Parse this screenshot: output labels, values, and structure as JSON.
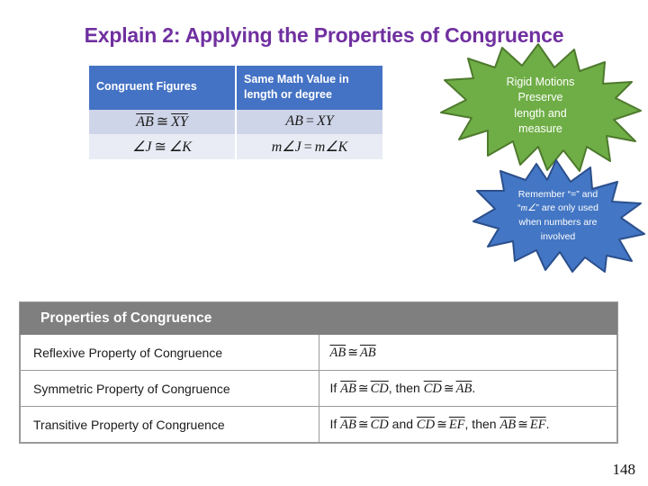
{
  "slide": {
    "title": "Explain 2:  Applying the Properties of Congruence",
    "title_color": "#7030A0",
    "page_number": "148"
  },
  "congruence_table": {
    "headers": [
      "Congruent Figures",
      "Same Math Value in length or degree"
    ],
    "header_bg": "#4472C4",
    "row_bg_1": "#CFD5E8",
    "row_bg_2": "#E9ECF5",
    "rows": [
      {
        "left_a": "AB",
        "left_op": "≅",
        "left_b": "XY",
        "right_a": "AB",
        "right_op": "=",
        "right_b": "XY"
      },
      {
        "left_a": "∠J",
        "left_op": "≅",
        "left_b": "∠K",
        "right_a": "m∠J",
        "right_op": "=",
        "right_b": "m∠K"
      }
    ]
  },
  "bursts": {
    "green": {
      "color": "#6FAE46",
      "outline": "#4E7A2E",
      "lines": [
        "Rigid Motions",
        "Preserve",
        "length and",
        "measure"
      ]
    },
    "blue": {
      "color": "#4376C4",
      "outline": "#2B4F8C",
      "line1": "Remember “=” and",
      "line2_math": "m∠",
      "line2_pre": "“",
      "line2_post": "” are only used",
      "line3": "when numbers are",
      "line4": "involved"
    }
  },
  "properties_table": {
    "header": "Properties of Congruence",
    "header_bg": "#7F7F7F",
    "rows": [
      {
        "name": "Reflexive Property of Congruence",
        "statement_parts": [
          {
            "t": "AB",
            "style": "seg"
          },
          {
            "t": "≅",
            "style": "cong"
          },
          {
            "t": "AB",
            "style": "seg"
          }
        ]
      },
      {
        "name": "Symmetric Property of Congruence",
        "statement_parts": [
          {
            "t": "If ",
            "style": "plain"
          },
          {
            "t": "AB",
            "style": "seg"
          },
          {
            "t": "≅",
            "style": "cong"
          },
          {
            "t": "CD",
            "style": "seg"
          },
          {
            "t": ", then ",
            "style": "plain"
          },
          {
            "t": "CD",
            "style": "seg"
          },
          {
            "t": "≅",
            "style": "cong"
          },
          {
            "t": "AB",
            "style": "seg"
          },
          {
            "t": ".",
            "style": "plain"
          }
        ]
      },
      {
        "name": "Transitive Property of Congruence",
        "statement_parts": [
          {
            "t": "If ",
            "style": "plain"
          },
          {
            "t": "AB",
            "style": "seg"
          },
          {
            "t": "≅",
            "style": "cong"
          },
          {
            "t": "CD",
            "style": "seg"
          },
          {
            "t": " and ",
            "style": "plain"
          },
          {
            "t": "CD",
            "style": "seg"
          },
          {
            "t": "≅",
            "style": "cong"
          },
          {
            "t": "EF",
            "style": "seg"
          },
          {
            "t": ", then ",
            "style": "plain"
          },
          {
            "t": "AB",
            "style": "seg"
          },
          {
            "t": "≅",
            "style": "cong"
          },
          {
            "t": "EF",
            "style": "seg"
          },
          {
            "t": ".",
            "style": "plain"
          }
        ]
      }
    ]
  }
}
